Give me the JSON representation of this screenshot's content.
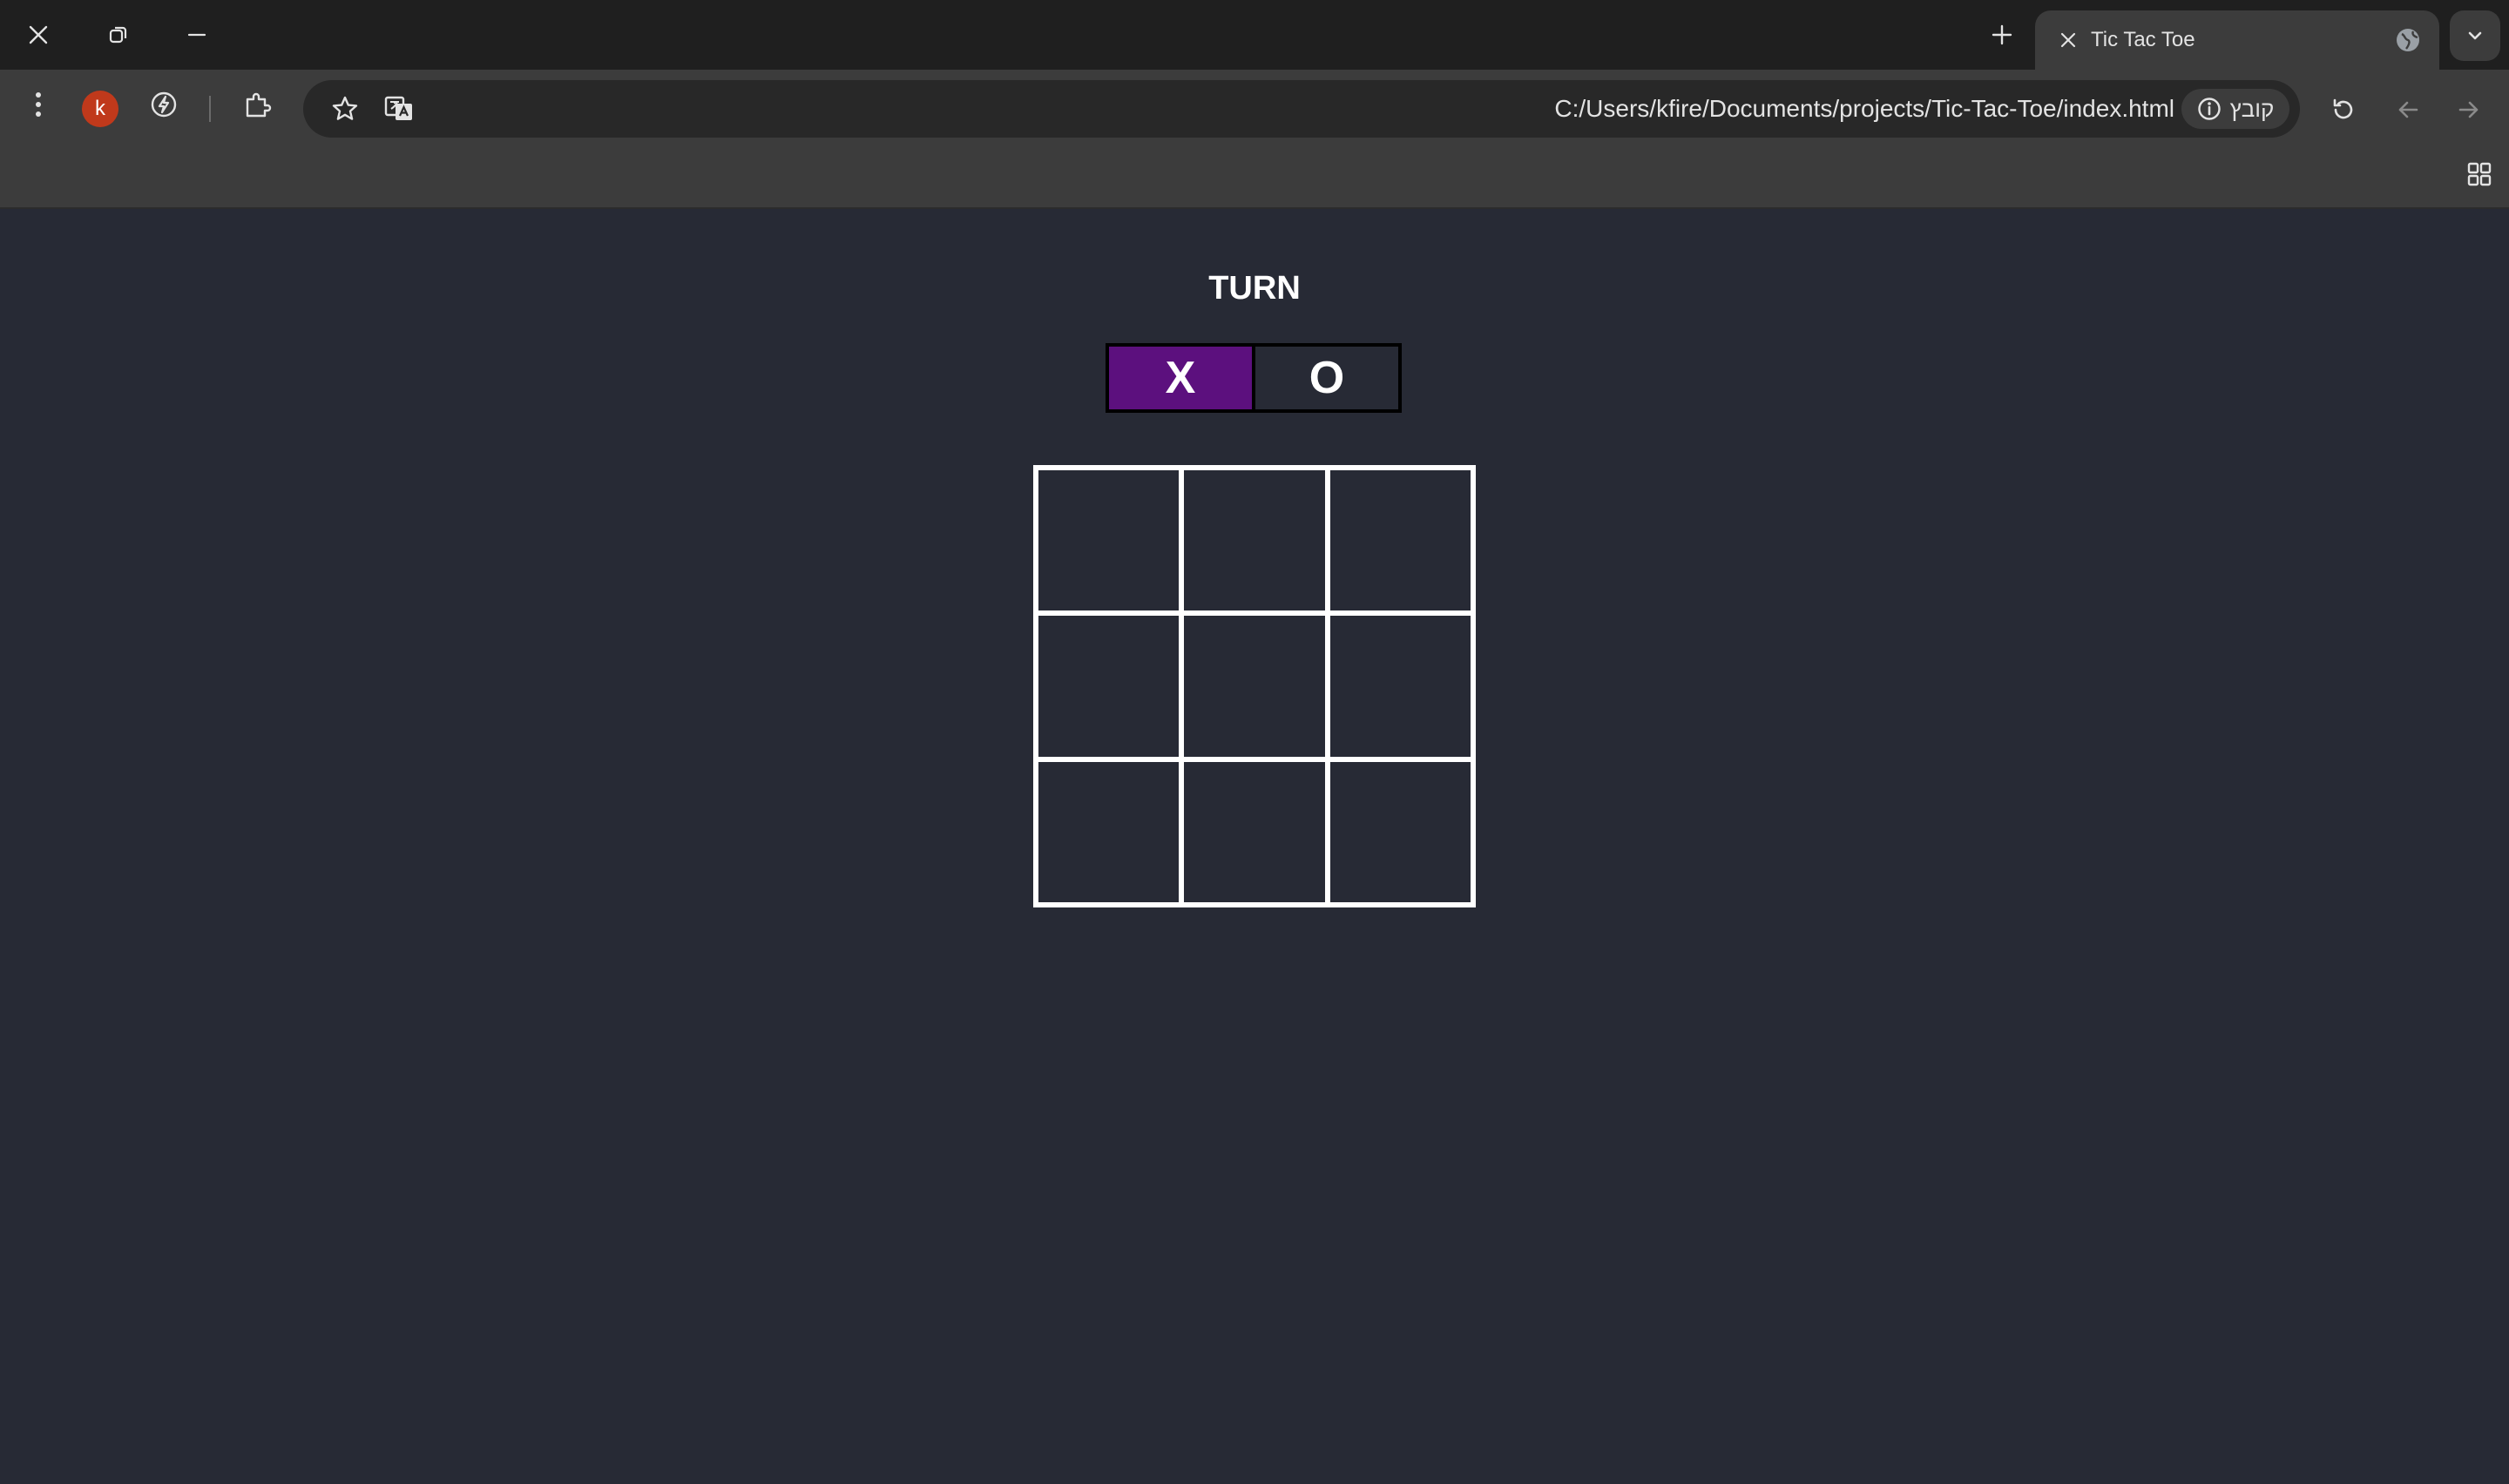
{
  "browser": {
    "tab_title": "Tic Tac Toe",
    "url": "C:/Users/kfire/Documents/projects/Tic-Tac-Toe/index.html",
    "site_chip_label": "קובץ",
    "profile_initial": "k",
    "colors": {
      "tabstrip": "#1f1f1f",
      "toolbar": "#3c3c3c",
      "omnibox": "#282828",
      "avatar": "#c0391b"
    }
  },
  "game": {
    "turn_label": "TURN",
    "players": [
      "X",
      "O"
    ],
    "active_player": "X",
    "board": [
      "",
      "",
      "",
      "",
      "",
      "",
      "",
      "",
      ""
    ],
    "colors": {
      "background": "#272a35",
      "active_turn": "#5c107e",
      "board_lines": "#ffffff"
    }
  }
}
